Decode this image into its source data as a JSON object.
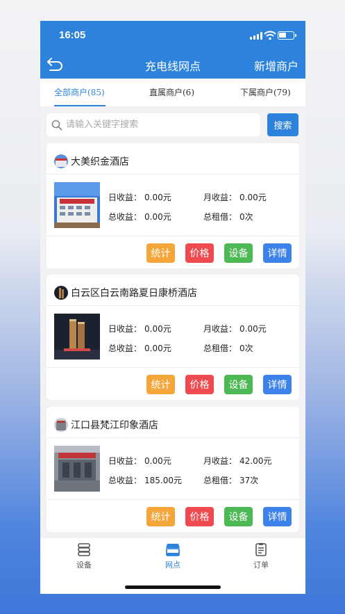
{
  "status_bar": {
    "time": "16:05"
  },
  "header": {
    "title": "充电线网点",
    "action_label": "新增商户"
  },
  "tabs": [
    {
      "label": "全部商户(85)",
      "active": true
    },
    {
      "label": "直属商户(6)",
      "active": false
    },
    {
      "label": "下属商户(79)",
      "active": false
    }
  ],
  "search": {
    "placeholder": "请输入关键字搜索",
    "value": "",
    "button_label": "搜索"
  },
  "labels": {
    "daily": "日收益：",
    "monthly": "月收益：",
    "total": "总收益：",
    "rentals": "总租借："
  },
  "merchants": [
    {
      "name": "大美织金酒店",
      "daily": "0.00元",
      "monthly": "0.00元",
      "total": "0.00元",
      "rentals": "0次"
    },
    {
      "name": "白云区白云南路夏日康桥酒店",
      "daily": "0.00元",
      "monthly": "0.00元",
      "total": "0.00元",
      "rentals": "0次"
    },
    {
      "name": "江口县梵江印象酒店",
      "daily": "0.00元",
      "monthly": "42.00元",
      "total": "185.00元",
      "rentals": "37次"
    }
  ],
  "actions": {
    "stats": "统计",
    "price": "价格",
    "device": "设备",
    "detail": "详情"
  },
  "bottom_nav": [
    {
      "label": "设备",
      "icon": "device-icon",
      "active": false
    },
    {
      "label": "网点",
      "icon": "store-icon",
      "active": true
    },
    {
      "label": "订单",
      "icon": "order-icon",
      "active": false
    }
  ],
  "colors": {
    "primary": "#2d83dc",
    "stats": "#f4a63a",
    "price": "#ef4a4f",
    "device": "#4cb955",
    "detail": "#3c82e8"
  }
}
